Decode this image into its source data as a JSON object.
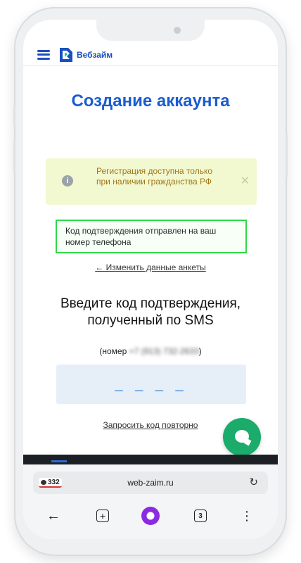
{
  "header": {
    "logo_text": "Вебзайм"
  },
  "page": {
    "title": "Создание аккаунта"
  },
  "notice": {
    "text": "Регистрация доступна только при наличии гражданства РФ"
  },
  "success": {
    "text": "Код подтверждения отправлен на ваш номер телефона"
  },
  "links": {
    "edit": "← Изменить данные анкеты",
    "resend": "Запросить код повторно"
  },
  "verification": {
    "prompt": "Введите код подтверждения, полученный по SMS",
    "phone_prefix": "(номер ",
    "phone_masked": "+7 (913) 732-2633",
    "phone_suffix": ")",
    "code_placeholder": "_ _ _ _"
  },
  "browser": {
    "tab_badge": "332",
    "url": "web-zaim.ru",
    "tabs_count": "3"
  },
  "colors": {
    "brand_blue": "#1a5bd0",
    "success_border": "#2fd84a",
    "notice_bg": "#f2f8cf",
    "chat_green": "#1bab6a",
    "alice_purple": "#8a2be2"
  },
  "icons": {
    "menu": "hamburger-icon",
    "info": "info-icon",
    "close": "close-icon",
    "chat": "chat-bubble-icon",
    "reload": "reload-icon",
    "back": "arrow-left-icon",
    "new_tab": "plus-icon",
    "assistant": "alice-icon",
    "more": "more-vertical-icon"
  }
}
